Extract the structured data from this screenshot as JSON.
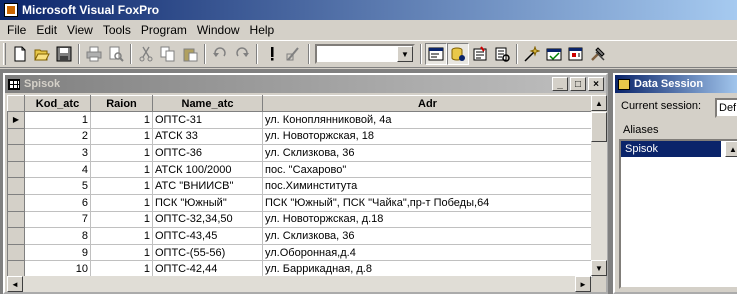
{
  "app": {
    "title": "Microsoft Visual FoxPro"
  },
  "menu": [
    "File",
    "Edit",
    "View",
    "Tools",
    "Program",
    "Window",
    "Help"
  ],
  "toolbar": {
    "buttons": [
      "new-icon",
      "open-icon",
      "save-icon",
      "print-icon",
      "print-preview-icon",
      "cut-icon",
      "copy-icon",
      "paste-icon",
      "undo-icon",
      "redo-icon",
      "run-icon",
      "modify-form-icon",
      "command-window-icon",
      "data-session-icon",
      "properties-icon",
      "project-manager-icon",
      "form-wizard-icon",
      "report-designer-icon",
      "builder-icon",
      "tools-icon"
    ],
    "combo_value": ""
  },
  "browse_window": {
    "title": "Spisok",
    "columns": [
      "Kod_atc",
      "Raion",
      "Name_atc",
      "Adr"
    ],
    "rows": [
      [
        "1",
        "1",
        "ОПТС-31",
        "ул. Коноплянниковой, 4а"
      ],
      [
        "2",
        "1",
        "АТСК 33",
        "ул. Новоторжская, 18"
      ],
      [
        "3",
        "1",
        "ОПТС-36",
        "ул. Склизкова, 36"
      ],
      [
        "4",
        "1",
        "АТСК 100/2000",
        "пос. \"Сахарово\""
      ],
      [
        "5",
        "1",
        "АТС \"ВНИИСВ\"",
        "пос.Химинститута"
      ],
      [
        "6",
        "1",
        "ПСК \"Южный\"",
        "ПСК \"Южный\", ПСК \"Чайка\",пр-т Победы,64"
      ],
      [
        "7",
        "1",
        "ОПТС-32,34,50",
        "ул. Новоторжская, д.18"
      ],
      [
        "8",
        "1",
        "ОПТС-43,45",
        "ул. Склизкова, 36"
      ],
      [
        "9",
        "1",
        "ОПТС-(55-56)",
        "ул.Оборонная,д.4"
      ],
      [
        "10",
        "1",
        "ОПТС-42,44",
        "ул. Баррикадная, д.8"
      ]
    ],
    "current_row": 0
  },
  "data_session": {
    "title": "Data Session",
    "current_session_label": "Current session:",
    "current_session_value": "Def",
    "aliases_label": "Aliases",
    "aliases": [
      "Spisok"
    ]
  }
}
